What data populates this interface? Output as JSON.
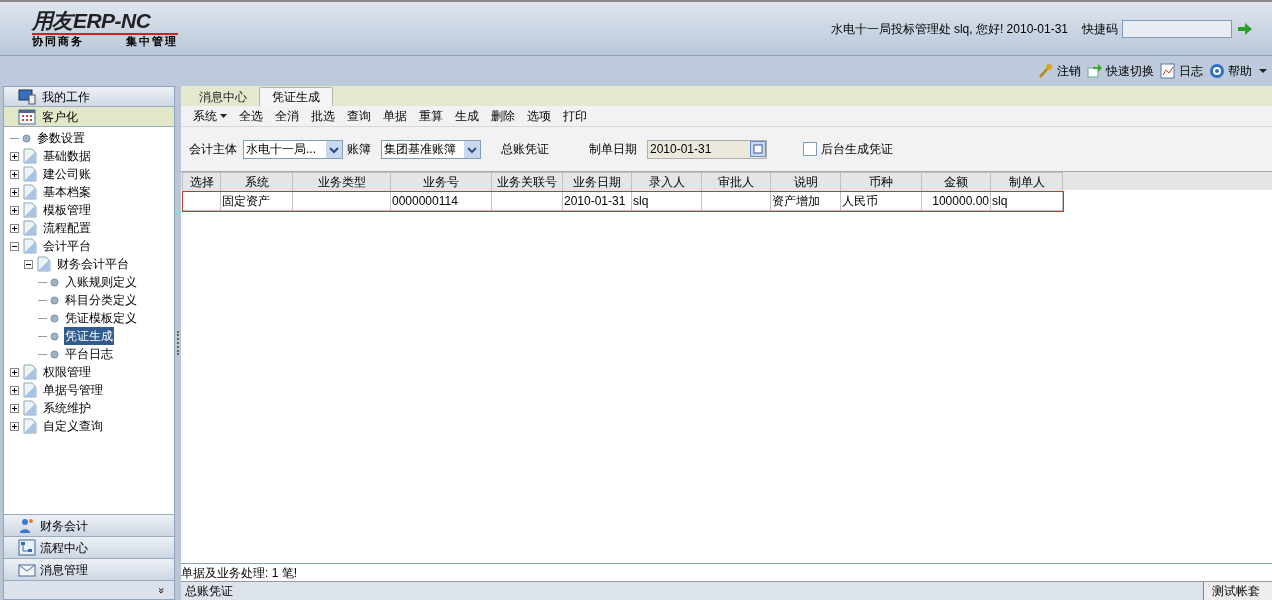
{
  "header": {
    "logo": "用友ERP-NC",
    "slogan_left": "协同商务",
    "slogan_right": "集中管理",
    "greeting": "水电十一局投标管理处 slq, 您好! 2010-01-31",
    "shortcut_label": "快捷码"
  },
  "top_links": [
    {
      "label": "注销",
      "kind": "key"
    },
    {
      "label": "快速切换",
      "kind": "switch"
    },
    {
      "label": "日志",
      "kind": "log"
    },
    {
      "label": "帮助",
      "kind": "help"
    }
  ],
  "sidebar": {
    "top_sections": [
      {
        "label": "我的工作",
        "kind": "monitor",
        "selected": false
      },
      {
        "label": "客户化",
        "kind": "grid",
        "selected": true
      }
    ],
    "tree": [
      {
        "label": "参数设置",
        "kind": "leaf",
        "selected": false
      },
      {
        "label": "基础数据",
        "kind": "folder",
        "expanded": false,
        "selected": false
      },
      {
        "label": "建公司账",
        "kind": "folder",
        "expanded": false,
        "selected": false
      },
      {
        "label": "基本档案",
        "kind": "folder",
        "expanded": false,
        "selected": false
      },
      {
        "label": "模板管理",
        "kind": "folder",
        "expanded": false,
        "selected": false
      },
      {
        "label": "流程配置",
        "kind": "folder",
        "expanded": false,
        "selected": false
      },
      {
        "label": "会计平台",
        "kind": "folder",
        "expanded": true,
        "selected": false,
        "children": [
          {
            "label": "财务会计平台",
            "kind": "folder",
            "expanded": true,
            "selected": false,
            "children": [
              {
                "label": "入账规则定义",
                "kind": "leaf",
                "selected": false
              },
              {
                "label": "科目分类定义",
                "kind": "leaf",
                "selected": false
              },
              {
                "label": "凭证模板定义",
                "kind": "leaf",
                "selected": false
              },
              {
                "label": "凭证生成",
                "kind": "leaf",
                "selected": true
              },
              {
                "label": "平台日志",
                "kind": "leaf",
                "selected": false
              }
            ]
          }
        ]
      },
      {
        "label": "权限管理",
        "kind": "folder",
        "expanded": false,
        "selected": false
      },
      {
        "label": "单据号管理",
        "kind": "folder",
        "expanded": false,
        "selected": false
      },
      {
        "label": "系统维护",
        "kind": "folder",
        "expanded": false,
        "selected": false
      },
      {
        "label": "自定义查询",
        "kind": "folder",
        "expanded": false,
        "selected": false
      }
    ],
    "bottom_sections": [
      {
        "label": "财务会计",
        "kind": "people"
      },
      {
        "label": "流程中心",
        "kind": "flow"
      },
      {
        "label": "消息管理",
        "kind": "mail"
      }
    ],
    "more": "»"
  },
  "tabs": [
    {
      "label": "消息中心",
      "selected": false
    },
    {
      "label": "凭证生成",
      "selected": true
    }
  ],
  "toolbar": [
    {
      "label": "系统",
      "dropdown": true
    },
    {
      "label": "全选",
      "dropdown": false
    },
    {
      "label": "全消",
      "dropdown": false
    },
    {
      "label": "批选",
      "dropdown": false
    },
    {
      "label": "查询",
      "dropdown": false
    },
    {
      "label": "单据",
      "dropdown": false
    },
    {
      "label": "重算",
      "dropdown": false
    },
    {
      "label": "生成",
      "dropdown": false
    },
    {
      "label": "删除",
      "dropdown": false
    },
    {
      "label": "选项",
      "dropdown": false
    },
    {
      "label": "打印",
      "dropdown": false
    }
  ],
  "form": {
    "entity_label": "会计主体",
    "entity_value": "水电十一局...",
    "book_label": "账簿",
    "book_value": "集团基准账簿",
    "voucher_label": "总账凭证",
    "date_label": "制单日期",
    "date_value": "2010-01-31",
    "background_label": "后台生成凭证",
    "background_checked": false
  },
  "table": {
    "columns": [
      "选择",
      "系统",
      "业务类型",
      "业务号",
      "业务关联号",
      "业务日期",
      "录入人",
      "审批人",
      "说明",
      "币种",
      "金额",
      "制单人"
    ],
    "rows": [
      {
        "selected": true,
        "cells": [
          "",
          "固定资产",
          "",
          "0000000114",
          "",
          "2010-01-31",
          "slq",
          "",
          "资产增加",
          "人民币",
          "100000.00",
          "slq"
        ]
      }
    ]
  },
  "status_message": "单据及业务处理: 1 笔!",
  "status_bar": {
    "left": "总账凭证",
    "right": "测试帐套"
  }
}
